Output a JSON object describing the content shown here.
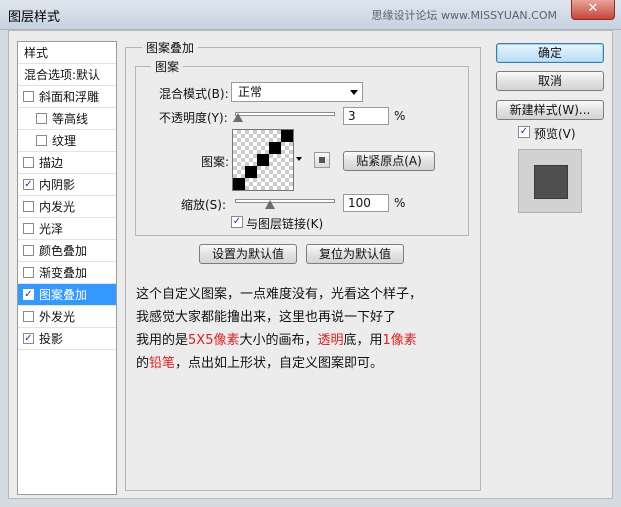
{
  "window": {
    "title": "图层样式",
    "watermark": "思缘设计论坛 www.MISSYUAN.COM",
    "close_glyph": "✕"
  },
  "left_panel": {
    "header": "样式",
    "blend_options": "混合选项:默认",
    "items": [
      {
        "label": "斜面和浮雕",
        "checked": false,
        "indent": false
      },
      {
        "label": "等高线",
        "checked": false,
        "indent": true
      },
      {
        "label": "纹理",
        "checked": false,
        "indent": true
      },
      {
        "label": "描边",
        "checked": false,
        "indent": false
      },
      {
        "label": "内阴影",
        "checked": true,
        "indent": false
      },
      {
        "label": "内发光",
        "checked": false,
        "indent": false
      },
      {
        "label": "光泽",
        "checked": false,
        "indent": false
      },
      {
        "label": "颜色叠加",
        "checked": false,
        "indent": false
      },
      {
        "label": "渐变叠加",
        "checked": false,
        "indent": false
      },
      {
        "label": "图案叠加",
        "checked": true,
        "indent": false,
        "active": true
      },
      {
        "label": "外发光",
        "checked": false,
        "indent": false
      },
      {
        "label": "投影",
        "checked": true,
        "indent": false
      }
    ]
  },
  "main": {
    "group_title": "图案叠加",
    "subgroup_title": "图案",
    "blend_mode_label": "混合模式(B):",
    "blend_mode_value": "正常",
    "opacity_label": "不透明度(Y):",
    "opacity_value": "3",
    "opacity_unit": "%",
    "pattern_label": "图案:",
    "snap_origin_button": "贴紧原点(A)",
    "scale_label": "缩放(S):",
    "scale_value": "100",
    "scale_unit": "%",
    "link_with_layer_label": "与图层链接(K)",
    "link_with_layer_checked": true,
    "set_default_button": "设置为默认值",
    "reset_default_button": "复位为默认值",
    "pattern_cells": [
      [
        4,
        0
      ],
      [
        3,
        1
      ],
      [
        2,
        2
      ],
      [
        1,
        3
      ],
      [
        0,
        4
      ]
    ]
  },
  "note": {
    "line1": "这个自定义图案，一点难度没有，光看这个样子，",
    "line2": "我感觉大家都能撸出来，这里也再说一下好了",
    "line3_a": "我用的是",
    "line3_b": "5X5像素",
    "line3_c": "大小的画布，",
    "line3_d": "透明",
    "line3_e": "底，用",
    "line3_f": "1像素",
    "line4_a": "的",
    "line4_b": "铅笔",
    "line4_c": "，点出如上形状，自定义图案即可。"
  },
  "right_panel": {
    "ok_button": "确定",
    "cancel_button": "取消",
    "new_style_button": "新建样式(W)...",
    "preview_label": "预览(V)",
    "preview_checked": true
  }
}
